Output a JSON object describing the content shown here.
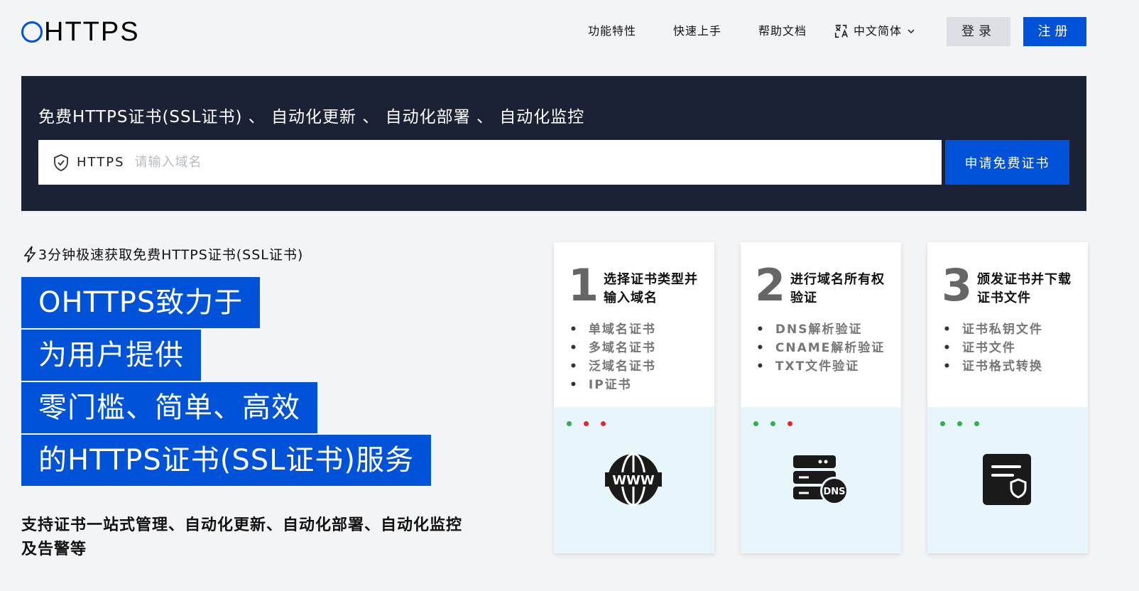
{
  "header": {
    "logo_text": "HTTPS",
    "nav": {
      "features": "功能特性",
      "quickstart": "快速上手",
      "docs": "帮助文档",
      "language": "中文简体"
    },
    "login": "登录",
    "register": "注册"
  },
  "hero": {
    "title": "免费HTTPS证书(SSL证书) 、 自动化更新 、 自动化部署 、 自动化监控",
    "search_prefix": "HTTPS",
    "search_placeholder": "请输入域名",
    "apply_button": "申请免费证书"
  },
  "left": {
    "tagline": "3分钟极速获取免费HTTPS证书(SSL证书)",
    "headline": [
      "OHTTPS致力于",
      "为用户提供",
      "零门槛、简单、高效",
      "的HTTPS证书(SSL证书)服务"
    ],
    "subtext": "支持证书一站式管理、自动化更新、自动化部署、自动化监控及告警等"
  },
  "steps": [
    {
      "number": "1",
      "title": "选择证书类型并输入域名",
      "items": [
        "单域名证书",
        "多域名证书",
        "泛域名证书",
        "IP证书"
      ],
      "icon": "www-globe-icon",
      "dots": [
        "#2bb24c",
        "#e5262b",
        "#e5262b"
      ]
    },
    {
      "number": "2",
      "title": "进行域名所有权验证",
      "items": [
        "DNS解析验证",
        "CNAME解析验证",
        "TXT文件验证"
      ],
      "icon": "dns-server-icon",
      "dots": [
        "#2bb24c",
        "#2bb24c",
        "#e5262b"
      ]
    },
    {
      "number": "3",
      "title": "颁发证书并下载证书文件",
      "items": [
        "证书私钥文件",
        "证书文件",
        "证书格式转换"
      ],
      "icon": "certificate-icon",
      "dots": [
        "#2bb24c",
        "#2bb24c",
        "#2bb24c"
      ]
    }
  ],
  "colors": {
    "brand_blue": "#0052d9",
    "hero_bg": "#1c2236",
    "card_bottom_bg": "#e8f6fc"
  }
}
